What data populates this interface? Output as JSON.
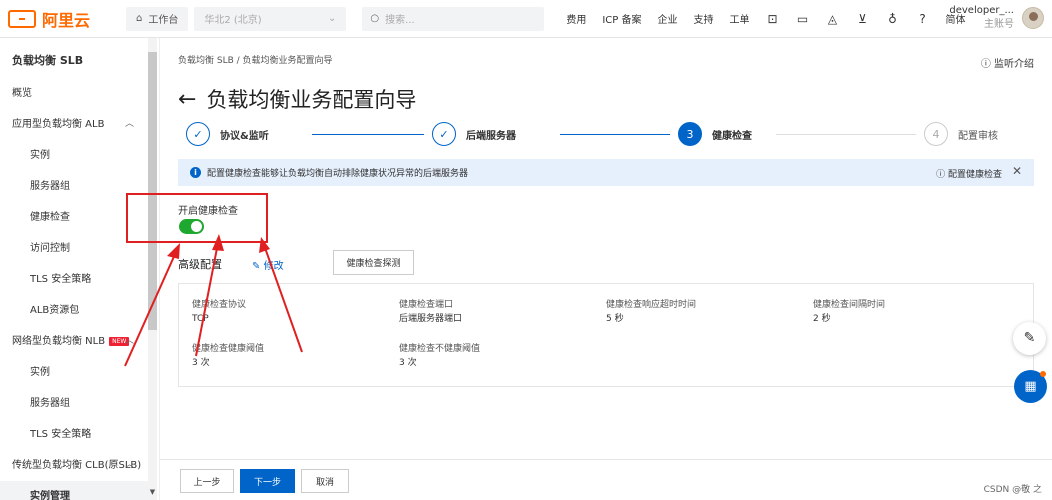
{
  "topbar": {
    "logo_text": "阿里云",
    "workbench": "工作台",
    "region": "华北2 (北京)",
    "search_placeholder": "搜索...",
    "links": [
      "费用",
      "ICP 备案",
      "企业",
      "支持",
      "工单"
    ],
    "lang": "简体",
    "user_name": "developer_...",
    "user_sub": "主账号"
  },
  "sidebar": {
    "title": "负载均衡 SLB",
    "items": [
      {
        "label": "概览"
      },
      {
        "label": "应用型负载均衡 ALB"
      },
      {
        "label": "实例"
      },
      {
        "label": "服务器组"
      },
      {
        "label": "健康检查"
      },
      {
        "label": "访问控制"
      },
      {
        "label": "TLS 安全策略"
      },
      {
        "label": "ALB资源包"
      },
      {
        "label": "网络型负载均衡 NLB",
        "badge": "NEW"
      },
      {
        "label": "实例"
      },
      {
        "label": "服务器组"
      },
      {
        "label": "TLS 安全策略"
      },
      {
        "label": "传统型负载均衡 CLB(原SLB)"
      },
      {
        "label": "实例管理"
      }
    ]
  },
  "page": {
    "breadcrumb": "负载均衡 SLB  /  负载均衡业务配置向导",
    "help": "监听介绍",
    "title": "负载均衡业务配置向导",
    "steps": [
      {
        "label": "协议&监听",
        "marker": "✓"
      },
      {
        "label": "后端服务器",
        "marker": "✓"
      },
      {
        "label": "健康检查",
        "marker": "3"
      },
      {
        "label": "配置审核",
        "marker": "4"
      }
    ],
    "banner": {
      "text": "配置健康检查能够让负载均衡自动排除健康状况异常的后端服务器",
      "help": "配置健康检查"
    },
    "health_check_label": "开启健康检查",
    "health_check_enabled": true,
    "advanced_label": "高级配置",
    "modify_label": "修改",
    "probe_button": "健康检查探测",
    "details": [
      {
        "key": "健康检查协议",
        "value": "TCP"
      },
      {
        "key": "健康检查端口",
        "value": "后端服务器端口"
      },
      {
        "key": "健康检查响应超时时间",
        "value": "5 秒"
      },
      {
        "key": "健康检查间隔时间",
        "value": "2 秒"
      },
      {
        "key": "健康检查健康阈值",
        "value": "3 次"
      },
      {
        "key": "健康检查不健康阈值",
        "value": "3 次"
      }
    ]
  },
  "footer": {
    "prev": "上一步",
    "next": "下一步",
    "cancel": "取消",
    "watermark": "CSDN @敬 之"
  },
  "colors": {
    "accent": "#0064c8",
    "brand": "#ff6a00",
    "toggle_on": "#1ea830",
    "annotation": "#e02020"
  }
}
